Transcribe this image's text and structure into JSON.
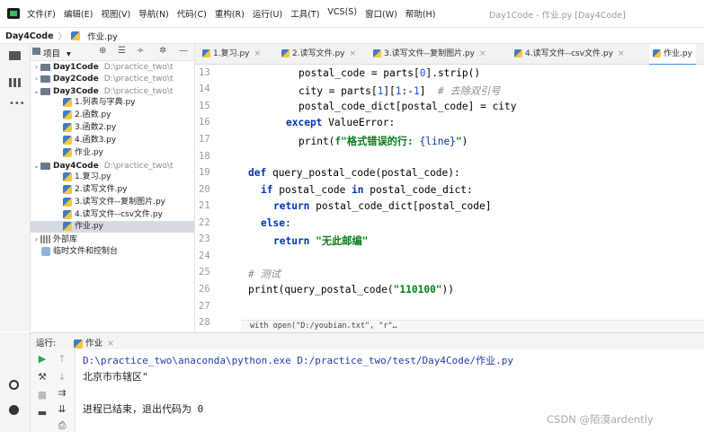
{
  "menubar": {
    "items": [
      "文件(F)",
      "编辑(E)",
      "视图(V)",
      "导航(N)",
      "代码(C)",
      "重构(R)",
      "运行(U)",
      "工具(T)",
      "VCS(S)",
      "窗口(W)",
      "帮助(H)"
    ],
    "window_title": "Day1Code - 作业.py [Day4Code]"
  },
  "navbar": {
    "project": "Day4Code",
    "file": "作业.py"
  },
  "project_panel": {
    "header_label": "项目",
    "tree": [
      {
        "type": "folder",
        "name": "Day1Code",
        "path": "D:\\practice_two\\t",
        "expanded": false
      },
      {
        "type": "folder",
        "name": "Day2Code",
        "path": "D:\\practice_two\\t",
        "expanded": false
      },
      {
        "type": "folder",
        "name": "Day3Code",
        "path": "D:\\practice_two\\t",
        "expanded": true
      },
      {
        "type": "file",
        "name": "1.列表与字典.py"
      },
      {
        "type": "file",
        "name": "2.函数.py"
      },
      {
        "type": "file",
        "name": "3.函数2.py"
      },
      {
        "type": "file",
        "name": "4.函数3.py"
      },
      {
        "type": "file",
        "name": "作业.py"
      },
      {
        "type": "folder",
        "name": "Day4Code",
        "path": "D:\\practice_two\\t",
        "expanded": true
      },
      {
        "type": "file",
        "name": "1.复习.py"
      },
      {
        "type": "file",
        "name": "2.读写文件.py"
      },
      {
        "type": "file",
        "name": "3.读写文件--复制图片.py"
      },
      {
        "type": "file",
        "name": "4.读写文件--csv文件.py"
      },
      {
        "type": "file",
        "name": "作业.py",
        "selected": true
      },
      {
        "type": "lib",
        "name": "外部库"
      },
      {
        "type": "scratch",
        "name": "临时文件和控制台"
      }
    ]
  },
  "tabs": [
    {
      "label": "1.复习.py",
      "active": false
    },
    {
      "label": "2.读写文件.py",
      "active": false
    },
    {
      "label": "3.读写文件--复制图片.py",
      "active": false
    },
    {
      "label": "4.读写文件--csv文件.py",
      "active": false
    },
    {
      "label": "作业.py",
      "active": true
    }
  ],
  "editor": {
    "line_numbers": [
      "13",
      "14",
      "15",
      "16",
      "17",
      "18",
      "19",
      "20",
      "21",
      "22",
      "23",
      "24",
      "25",
      "26",
      "27",
      "28"
    ],
    "hint": "with open(\"D:/youbian.txt\", \"r\"…"
  },
  "run_panel": {
    "label": "运行:",
    "tab": "作业",
    "output": [
      "D:\\practice_two\\anaconda\\python.exe D:/practice_two/test/Day4Code/作业.py",
      "北京市市辖区\"",
      "",
      "进程已结束，退出代码为 0"
    ]
  },
  "watermark": "CSDN @陌漠ardently",
  "colors": {
    "keyword": "#0033b3",
    "string": "#067d17",
    "comment": "#8c8c8c",
    "selection": "#d6dbe3",
    "output_path": "#1e3ea8"
  }
}
